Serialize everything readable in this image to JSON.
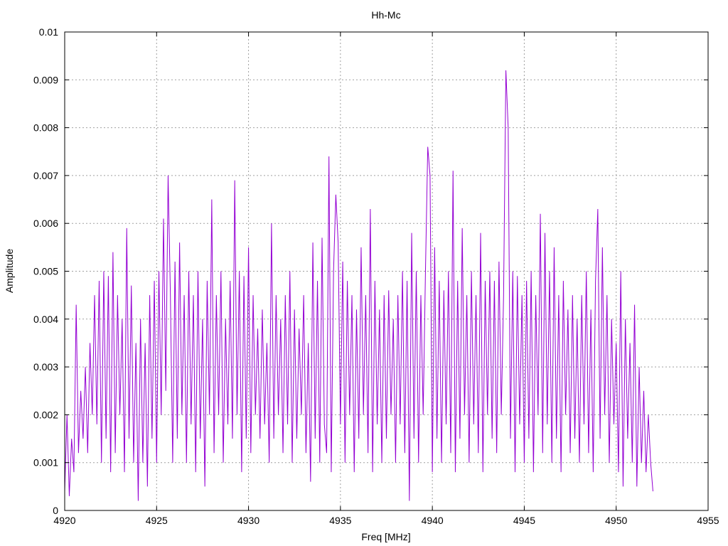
{
  "chart_data": {
    "type": "line",
    "title": "Hh-Mc",
    "xlabel": "Freq [MHz]",
    "ylabel": "Amplitude",
    "xlim": [
      4920,
      4955
    ],
    "ylim": [
      0,
      0.01
    ],
    "grid": true,
    "line_color": "#9400d3",
    "xticks": [
      "4920",
      "4925",
      "4930",
      "4935",
      "4940",
      "4945",
      "4950",
      "4955"
    ],
    "yticks": [
      "0",
      "0.001",
      "0.002",
      "0.003",
      "0.004",
      "0.005",
      "0.006",
      "0.007",
      "0.008",
      "0.009",
      "0.01"
    ],
    "series": [
      {
        "x_start": 4920,
        "x_step": 0.125,
        "values": [
          0.0004,
          0.002,
          0.0003,
          0.0015,
          0.0008,
          0.0043,
          0.0012,
          0.0025,
          0.0015,
          0.003,
          0.0012,
          0.0035,
          0.002,
          0.0045,
          0.0018,
          0.0048,
          0.001,
          0.005,
          0.0015,
          0.0049,
          0.0008,
          0.0054,
          0.0012,
          0.0045,
          0.002,
          0.004,
          0.0008,
          0.0059,
          0.0015,
          0.0047,
          0.001,
          0.0035,
          0.0002,
          0.004,
          0.001,
          0.0035,
          0.0005,
          0.0045,
          0.0015,
          0.0048,
          0.001,
          0.005,
          0.002,
          0.0061,
          0.0025,
          0.007,
          0.0045,
          0.001,
          0.0052,
          0.0015,
          0.0056,
          0.002,
          0.0045,
          0.001,
          0.005,
          0.0018,
          0.0045,
          0.0008,
          0.005,
          0.0015,
          0.004,
          0.0005,
          0.0048,
          0.002,
          0.0065,
          0.0012,
          0.0045,
          0.002,
          0.005,
          0.001,
          0.004,
          0.0018,
          0.0048,
          0.0015,
          0.0069,
          0.002,
          0.005,
          0.0008,
          0.0049,
          0.0015,
          0.0055,
          0.0012,
          0.0045,
          0.002,
          0.0038,
          0.0015,
          0.0042,
          0.0018,
          0.0035,
          0.001,
          0.006,
          0.0015,
          0.0045,
          0.002,
          0.004,
          0.0012,
          0.0045,
          0.0018,
          0.005,
          0.001,
          0.0042,
          0.0015,
          0.0038,
          0.002,
          0.0045,
          0.0012,
          0.0035,
          0.0006,
          0.0056,
          0.0015,
          0.0048,
          0.001,
          0.0057,
          0.0018,
          0.0012,
          0.0074,
          0.0008,
          0.005,
          0.0066,
          0.0056,
          0.0018,
          0.0052,
          0.001,
          0.0048,
          0.002,
          0.0045,
          0.0008,
          0.0042,
          0.0015,
          0.0055,
          0.002,
          0.0045,
          0.0012,
          0.0063,
          0.0008,
          0.0048,
          0.0018,
          0.0042,
          0.001,
          0.0045,
          0.0015,
          0.0046,
          0.002,
          0.004,
          0.001,
          0.0045,
          0.0018,
          0.005,
          0.0012,
          0.0048,
          0.0002,
          0.0058,
          0.0015,
          0.005,
          0.001,
          0.0045,
          0.002,
          0.005,
          0.0076,
          0.007,
          0.0008,
          0.0055,
          0.0015,
          0.0048,
          0.001,
          0.0046,
          0.0018,
          0.005,
          0.0012,
          0.0071,
          0.0008,
          0.0048,
          0.0015,
          0.0059,
          0.002,
          0.0045,
          0.001,
          0.005,
          0.0018,
          0.0045,
          0.0012,
          0.0058,
          0.0008,
          0.0048,
          0.002,
          0.005,
          0.0015,
          0.0048,
          0.0012,
          0.0052,
          0.002,
          0.0045,
          0.0092,
          0.008,
          0.0015,
          0.005,
          0.0008,
          0.0049,
          0.0018,
          0.0045,
          0.001,
          0.0048,
          0.0015,
          0.005,
          0.0008,
          0.0045,
          0.002,
          0.0062,
          0.0012,
          0.0058,
          0.0018,
          0.005,
          0.001,
          0.0055,
          0.0015,
          0.0045,
          0.0008,
          0.0048,
          0.002,
          0.0042,
          0.0012,
          0.0045,
          0.0015,
          0.004,
          0.001,
          0.0045,
          0.0018,
          0.005,
          0.0012,
          0.0042,
          0.0008,
          0.0048,
          0.0063,
          0.0015,
          0.0055,
          0.002,
          0.0045,
          0.001,
          0.004,
          0.0018,
          0.0035,
          0.0008,
          0.005,
          0.0005,
          0.004,
          0.0015,
          0.0035,
          0.001,
          0.0043,
          0.0005,
          0.003,
          0.001,
          0.0025,
          0.0008,
          0.002,
          0.001,
          0.0004
        ]
      }
    ]
  }
}
